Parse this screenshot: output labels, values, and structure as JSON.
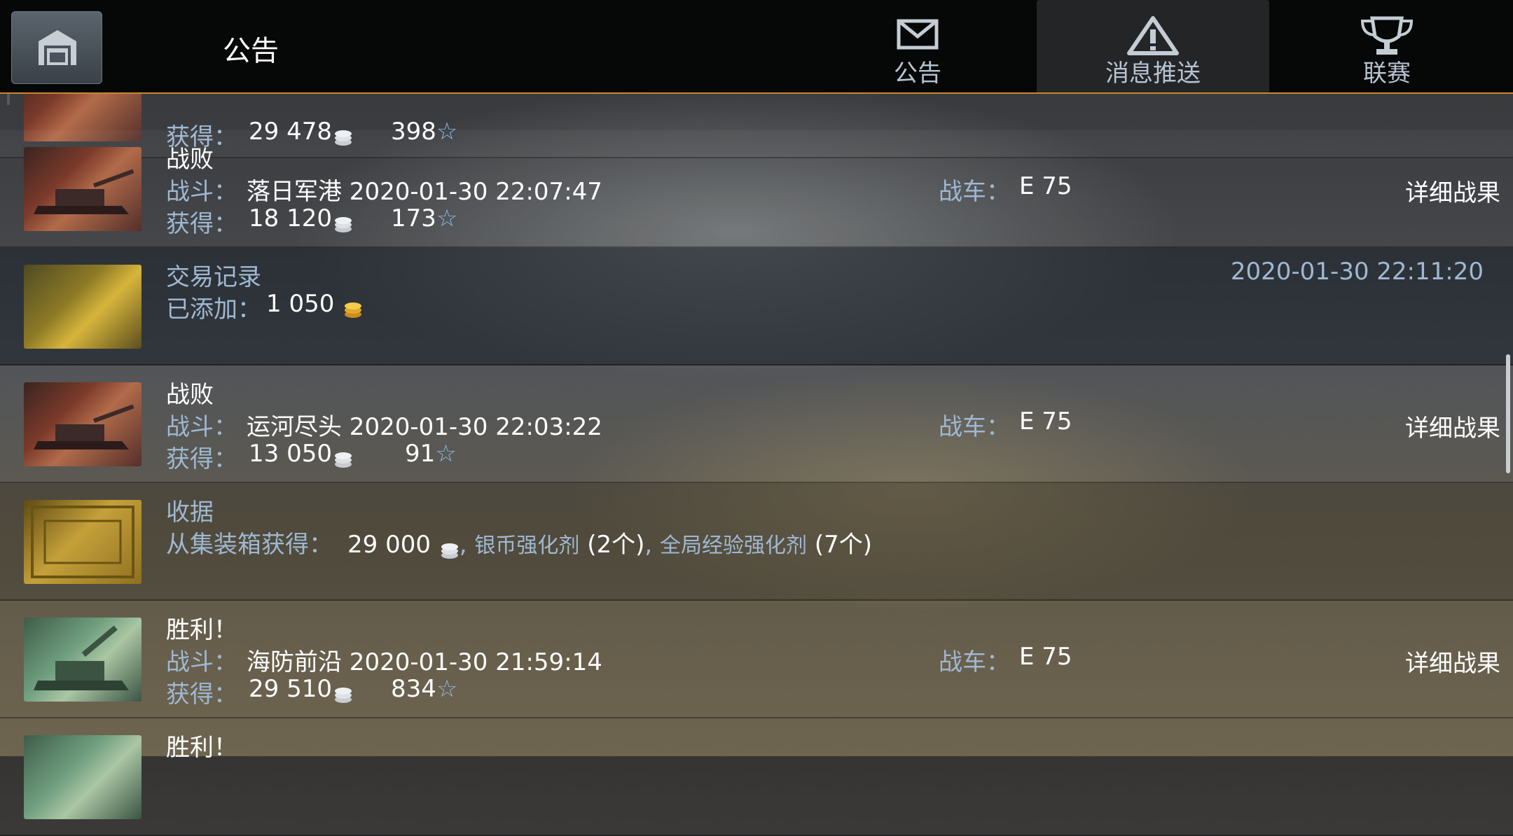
{
  "header": {
    "title": "公告",
    "tabs": [
      {
        "label": "公告",
        "icon": "envelope-icon"
      },
      {
        "label": "消息推送",
        "icon": "warning-icon",
        "active": true
      },
      {
        "label": "联赛",
        "icon": "trophy-icon"
      }
    ]
  },
  "rows": [
    {
      "type": "partial",
      "earn_label": "获得：",
      "silver": "29 478",
      "xp": "398"
    },
    {
      "type": "battle",
      "result": "战败",
      "battle_label": "战斗：",
      "map_time": "落日军港 2020-01-30 22:07:47",
      "tank_label": "战车：",
      "tank": "E 75",
      "earn_label": "获得：",
      "silver": "18 120",
      "xp": "173",
      "detail": "详细战果"
    },
    {
      "type": "transaction",
      "title": "交易记录",
      "added_label": "已添加：",
      "gold": "1 050",
      "timestamp": "2020-01-30 22:11:20"
    },
    {
      "type": "battle",
      "result": "战败",
      "battle_label": "战斗：",
      "map_time": "运河尽头 2020-01-30 22:03:22",
      "tank_label": "战车：",
      "tank": "E 75",
      "earn_label": "获得：",
      "silver": "13 050",
      "xp": "91",
      "detail": "详细战果"
    },
    {
      "type": "receipt",
      "title": "收据",
      "source_label": "从集装箱获得：",
      "silver": "29 000",
      "item1": "银币强化剂",
      "item1_count": "(2个)",
      "item2": "全局经验强化剂",
      "item2_count": "(7个)",
      "sep": ","
    },
    {
      "type": "battle",
      "result": "胜利！",
      "battle_label": "战斗：",
      "map_time": "海防前沿 2020-01-30 21:59:14",
      "tank_label": "战车：",
      "tank": "E 75",
      "earn_label": "获得：",
      "silver": "29 510",
      "xp": "834",
      "detail": "详细战果"
    },
    {
      "type": "partial",
      "result": "胜利！"
    }
  ],
  "icons": {
    "silver": "silver-coin-icon",
    "gold": "gold-coin-icon",
    "xp": "star-icon",
    "star_glyph": "☆"
  },
  "colors": {
    "accent": "#c9872e",
    "label_blue": "#9fb8d2",
    "topbar": "#060707"
  }
}
